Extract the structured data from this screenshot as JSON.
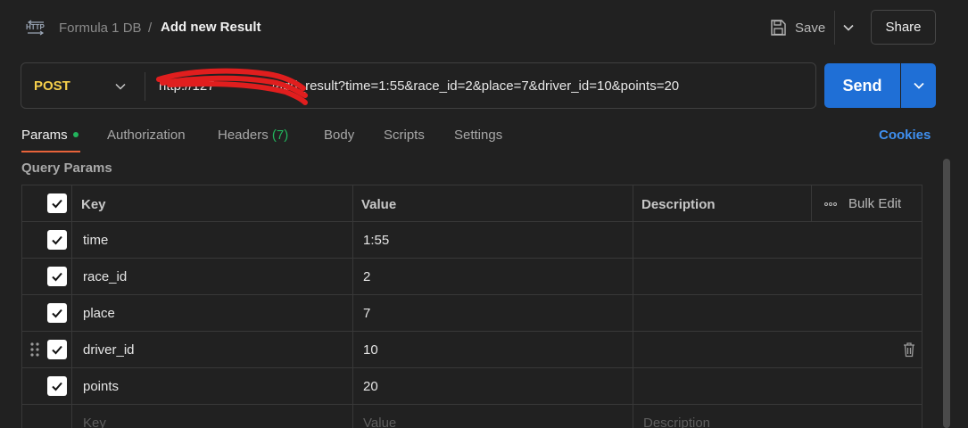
{
  "header": {
    "icon": "http-icon",
    "collection": "Formula 1 DB",
    "separator": "/",
    "title": "Add new Result",
    "save_label": "Save",
    "share_label": "Share"
  },
  "request": {
    "method": "POST",
    "url_visible": "/add_result?time=1:55&race_id=2&place=7&driver_id=10&points=20",
    "url_prefix_visible": "http://127",
    "send_label": "Send"
  },
  "tabs": {
    "params": "Params",
    "authorization": "Authorization",
    "headers": "Headers",
    "headers_count": "(7)",
    "body": "Body",
    "scripts": "Scripts",
    "settings": "Settings",
    "cookies": "Cookies"
  },
  "query_params": {
    "title": "Query Params",
    "columns": {
      "key": "Key",
      "value": "Value",
      "description": "Description",
      "bulk_edit": "Bulk Edit"
    },
    "rows": [
      {
        "key": "time",
        "value": "1:55",
        "checked": true
      },
      {
        "key": "race_id",
        "value": "2",
        "checked": true
      },
      {
        "key": "place",
        "value": "7",
        "checked": true
      },
      {
        "key": "driver_id",
        "value": "10",
        "checked": true
      },
      {
        "key": "points",
        "value": "20",
        "checked": true
      }
    ],
    "new_row": {
      "key_placeholder": "Key",
      "value_placeholder": "Value",
      "description_placeholder": "Description"
    }
  },
  "colors": {
    "accent": "#1f6fd6",
    "method_post": "#f5cf4b",
    "active_tab_underline": "#e8633a",
    "status_dot": "#22b35c",
    "link": "#3f8fef"
  }
}
